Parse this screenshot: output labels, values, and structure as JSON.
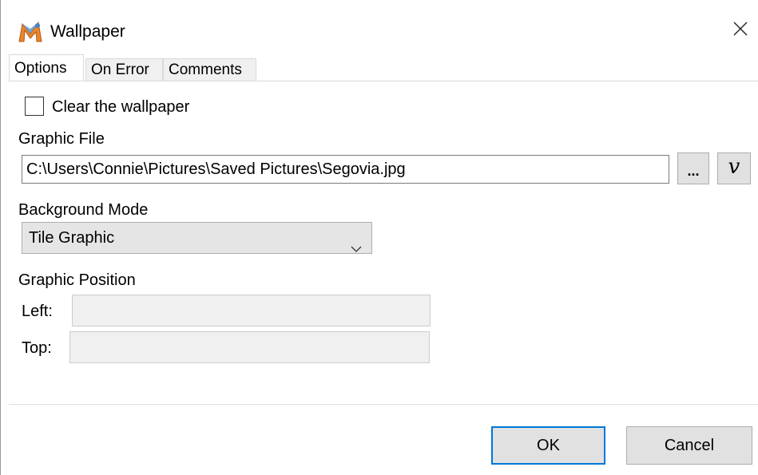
{
  "window": {
    "title": "Wallpaper",
    "app_icon": "macro-m-icon",
    "close_icon": "close-icon"
  },
  "tabs": [
    {
      "label": "Options",
      "active": true
    },
    {
      "label": "On Error",
      "active": false
    },
    {
      "label": "Comments",
      "active": false
    }
  ],
  "options": {
    "clear_wallpaper": {
      "label": "Clear the wallpaper",
      "checked": false
    },
    "graphic_file": {
      "label": "Graphic File",
      "value": "C:\\Users\\Connie\\Pictures\\Saved Pictures\\Segovia.jpg",
      "browse_label": "...",
      "variable_label": "v"
    },
    "background_mode": {
      "label": "Background Mode",
      "selected": "Tile Graphic"
    },
    "graphic_position": {
      "label": "Graphic Position",
      "left_label": "Left:",
      "left_value": "",
      "top_label": "Top:",
      "top_value": ""
    }
  },
  "buttons": {
    "ok": "OK",
    "cancel": "Cancel"
  },
  "colors": {
    "accent": "#0078d7",
    "button_face": "#e1e1e1",
    "disabled_field": "#f0f0f0"
  }
}
